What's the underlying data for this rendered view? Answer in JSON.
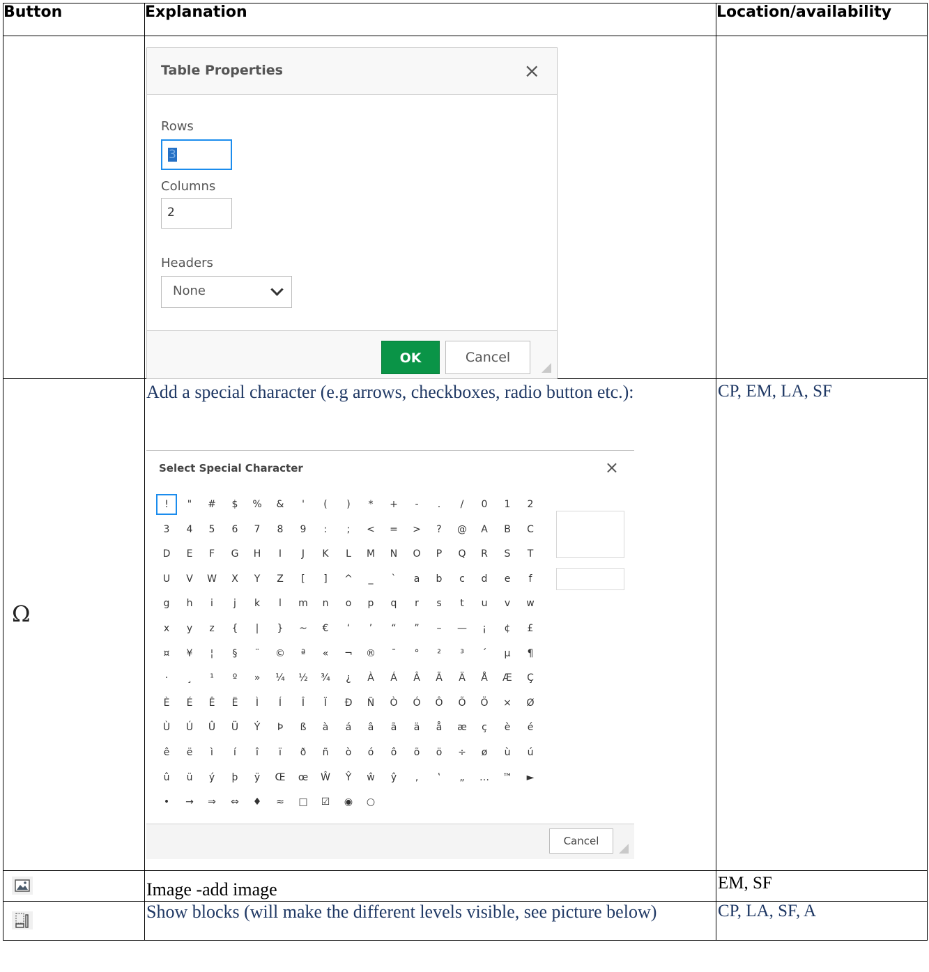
{
  "headers": [
    "Button",
    "Explanation",
    "Location/availability"
  ],
  "table_properties_dialog": {
    "title": "Table Properties",
    "close_glyph": "×",
    "rows_label": "Rows",
    "rows_value": "3",
    "columns_label": "Columns",
    "columns_value": "2",
    "headers_label": "Headers",
    "headers_value": "None",
    "ok_label": "OK",
    "cancel_label": "Cancel"
  },
  "special_char_row": {
    "icon": "omega-icon",
    "icon_glyph": "Ω",
    "explanation": "Add a special character (e.g arrows, checkboxes, radio button etc.):",
    "location": "CP, EM, LA, SF",
    "dialog": {
      "title": "Select Special Character",
      "close_glyph": "×",
      "cancel_label": "Cancel",
      "selected": "!",
      "chars": [
        "!",
        "\"",
        "#",
        "$",
        "%",
        "&",
        "'",
        "(",
        ")",
        "*",
        "+",
        "-",
        ".",
        "/",
        "0",
        "1",
        "2",
        "3",
        "4",
        "5",
        "6",
        "7",
        "8",
        "9",
        ":",
        ";",
        "<",
        "=",
        ">",
        "?",
        "@",
        "A",
        "B",
        "C",
        "D",
        "E",
        "F",
        "G",
        "H",
        "I",
        "J",
        "K",
        "L",
        "M",
        "N",
        "O",
        "P",
        "Q",
        "R",
        "S",
        "T",
        "U",
        "V",
        "W",
        "X",
        "Y",
        "Z",
        "[",
        "]",
        "^",
        "_",
        "`",
        "a",
        "b",
        "c",
        "d",
        "e",
        "f",
        "g",
        "h",
        "i",
        "j",
        "k",
        "l",
        "m",
        "n",
        "o",
        "p",
        "q",
        "r",
        "s",
        "t",
        "u",
        "v",
        "w",
        "x",
        "y",
        "z",
        "{",
        "|",
        "}",
        "~",
        "€",
        "‘",
        "’",
        "“",
        "”",
        "–",
        "—",
        "¡",
        "¢",
        "£",
        "¤",
        "¥",
        "¦",
        "§",
        "¨",
        "©",
        "ª",
        "«",
        "¬",
        "®",
        "¯",
        "°",
        "²",
        "³",
        "´",
        "µ",
        "¶",
        "·",
        "¸",
        "¹",
        "º",
        "»",
        "¼",
        "½",
        "¾",
        "¿",
        "À",
        "Á",
        "Â",
        "Ã",
        "Ä",
        "Å",
        "Æ",
        "Ç",
        "È",
        "É",
        "Ê",
        "Ë",
        "Ì",
        "Í",
        "Î",
        "Ï",
        "Ð",
        "Ñ",
        "Ò",
        "Ó",
        "Ô",
        "Õ",
        "Ö",
        "×",
        "Ø",
        "Ù",
        "Ú",
        "Û",
        "Ü",
        "Ý",
        "Þ",
        "ß",
        "à",
        "á",
        "â",
        "ã",
        "ä",
        "å",
        "æ",
        "ç",
        "è",
        "é",
        "ê",
        "ë",
        "ì",
        "í",
        "î",
        "ï",
        "ð",
        "ñ",
        "ò",
        "ó",
        "ô",
        "õ",
        "ö",
        "÷",
        "ø",
        "ù",
        "ú",
        "û",
        "ü",
        "ý",
        "þ",
        "ÿ",
        "Œ",
        "œ",
        "Ŵ",
        "Ŷ",
        "ŵ",
        "ŷ",
        "‚",
        "‛",
        "„",
        "…",
        "™",
        "►",
        "•",
        "→",
        "⇒",
        "⇔",
        "♦",
        "≈",
        "□",
        "☑",
        "◉",
        "○"
      ]
    }
  },
  "image_row": {
    "icon": "image-icon",
    "explanation": "Image -add image",
    "location": "EM, SF"
  },
  "blocks_row": {
    "icon": "show-blocks-icon",
    "explanation": "Show blocks (will make the different levels visible, see picture below)",
    "location": "CP, LA, SF, A"
  }
}
